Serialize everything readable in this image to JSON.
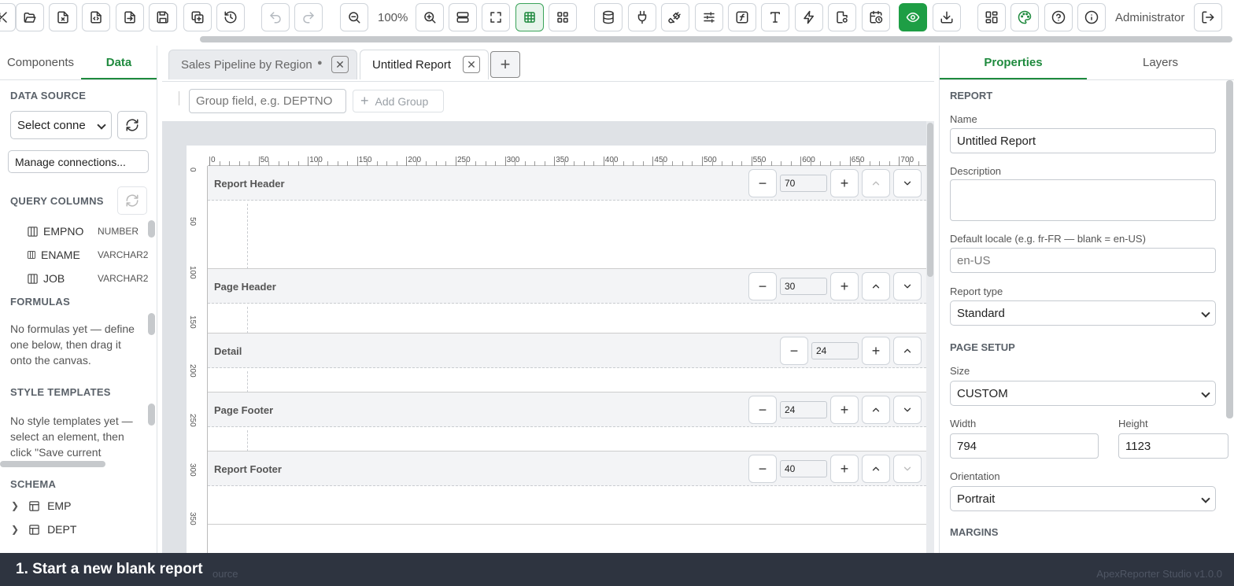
{
  "toolbar": {
    "zoom": "100%",
    "user": "Administrator"
  },
  "left_panel": {
    "tabs": [
      "Components",
      "Data"
    ],
    "data_source": {
      "heading": "DATA SOURCE",
      "select_value": "Select conne",
      "manage_label": "Manage connections..."
    },
    "query_columns": {
      "heading": "QUERY COLUMNS",
      "columns": [
        {
          "name": "EMPNO",
          "type": "NUMBER"
        },
        {
          "name": "ENAME",
          "type": "VARCHAR2"
        },
        {
          "name": "JOB",
          "type": "VARCHAR2"
        }
      ]
    },
    "formulas": {
      "heading": "FORMULAS",
      "empty_text": "No formulas yet — define one below, then drag it onto the canvas."
    },
    "style_templates": {
      "heading": "STYLE TEMPLATES",
      "empty_text": "No style templates yet — select an element, then click \"Save current"
    },
    "schema": {
      "heading": "SCHEMA",
      "tables": [
        "EMP",
        "DEPT"
      ]
    }
  },
  "doc_tabs": {
    "tabs": [
      {
        "label": "Sales Pipeline by Region",
        "dirty": "●"
      },
      {
        "label": "Untitled Report"
      }
    ],
    "add_label": "+"
  },
  "group_bar": {
    "placeholder": "Group field, e.g. DEPTNO",
    "add_group_label": "Add Group"
  },
  "ruler": {
    "h_ticks": [
      "0",
      "50",
      "100",
      "150",
      "200",
      "250",
      "300",
      "350",
      "400",
      "450",
      "500",
      "550",
      "600",
      "650",
      "700"
    ],
    "v_ticks": [
      "0",
      "50",
      "100",
      "150",
      "200",
      "250",
      "300",
      "350"
    ]
  },
  "bands": [
    {
      "name": "Report Header",
      "height": "70"
    },
    {
      "name": "Page Header",
      "height": "30"
    },
    {
      "name": "Detail",
      "height": "24"
    },
    {
      "name": "Page Footer",
      "height": "24"
    },
    {
      "name": "Report Footer",
      "height": "40"
    }
  ],
  "right_panel": {
    "tabs": [
      "Properties",
      "Layers"
    ],
    "report_heading": "REPORT",
    "name_label": "Name",
    "name_value": "Untitled Report",
    "description_label": "Description",
    "description_value": "",
    "locale_label": "Default locale (e.g. fr-FR — blank = en-US)",
    "locale_placeholder": "en-US",
    "report_type_label": "Report type",
    "report_type_value": "Standard",
    "page_setup_heading": "PAGE SETUP",
    "size_label": "Size",
    "size_value": "CUSTOM",
    "width_label": "Width",
    "width_value": "794",
    "height_label": "Height",
    "height_value": "1123",
    "orientation_label": "Orientation",
    "orientation_value": "Portrait",
    "margins_heading": "MARGINS"
  },
  "bottom_bar": {
    "caption": "1. Start a new blank report",
    "source_fragment": "ource",
    "version": "ApexReporter Studio v1.0.0"
  },
  "colors": {
    "accent": "#1f8a3e",
    "caption_bg": "#2e3440"
  }
}
